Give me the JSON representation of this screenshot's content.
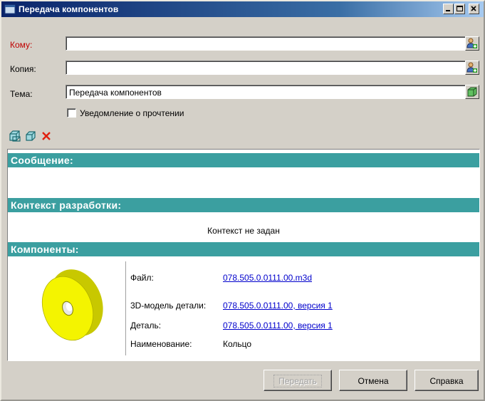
{
  "window": {
    "title": "Передача компонентов"
  },
  "form": {
    "to_label": "Кому:",
    "to_value": "",
    "cc_label": "Копия:",
    "cc_value": "",
    "subject_label": "Тема:",
    "subject_value": "Передача компонентов",
    "read_receipt_label": "Уведомление о прочтении",
    "read_receipt_checked": false
  },
  "sections": {
    "message_header": "Сообщение:",
    "context_header": "Контекст разработки:",
    "context_text": "Контекст не задан",
    "components_header": "Компоненты:"
  },
  "component": {
    "file_label": "Файл:",
    "file_value": "078.505.0.0111.00.m3d",
    "model_label": "3D-модель детали:",
    "model_value": "078.505.0.0111.00, версия 1",
    "part_label": "Деталь:",
    "part_value": "078.505.0.0111.00, версия 1",
    "name_label": "Наименование:",
    "name_value": "Кольцо"
  },
  "buttons": {
    "send": "Передать",
    "cancel": "Отмена",
    "help": "Справка"
  },
  "icons": [
    "add-contact-icon",
    "address-book-icon",
    "add-component-icon",
    "component-icon",
    "delete-icon",
    "ring-part-thumbnail"
  ],
  "colors": {
    "section_header": "#3b9fa0",
    "link": "#0000cc",
    "titlebar": "#0a246a"
  }
}
